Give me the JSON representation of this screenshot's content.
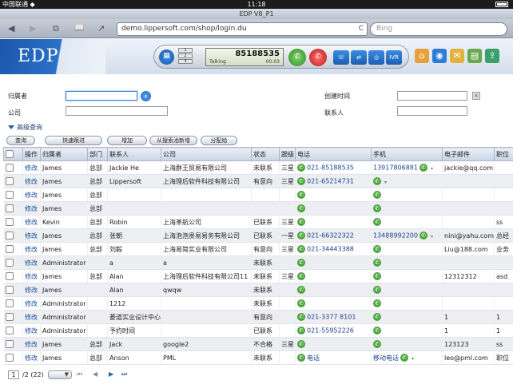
{
  "statusbar": {
    "carrier": "中国联通 ◆",
    "time": "11:18"
  },
  "browser": {
    "title": "EDP V8_P1",
    "url": "demo.lippersoft.com/shop/login.du",
    "search_placeholder": "Bing",
    "back": "◀",
    "forward": "▶",
    "tabs": "⧉",
    "bookmarks": "📖",
    "share": "↗",
    "reload": "C"
  },
  "header": {
    "logo": "EDP",
    "phone": {
      "lines": [
        "1",
        "2",
        "3"
      ],
      "number": "85188535",
      "state": "Talking",
      "duration": "00:03",
      "ivr": "IVR"
    }
  },
  "filter": {
    "owner_label": "归属者",
    "company_label": "公司",
    "created_label": "创建时间",
    "contact_label": "联系人"
  },
  "advanced": "高级查询",
  "toolbar": [
    "查询",
    "快速跟进",
    "增加",
    "从搜索池新增",
    "分配给"
  ],
  "table": {
    "headers": [
      "",
      "操作",
      "归属者",
      "部门",
      "联系人",
      "公司",
      "状态",
      "跟级",
      "电话",
      "手机",
      "电子邮件",
      "职位"
    ],
    "rows": [
      {
        "op": "修改",
        "owner": "James",
        "dept": "总部",
        "contact": "Jackie He",
        "company": "上海群王贸易有限公司",
        "status": "未联系",
        "level": "三星",
        "phone": "021-85188535",
        "mobile": "13917806881",
        "email": "jackie@qq.com",
        "title": ""
      },
      {
        "op": "修改",
        "owner": "James",
        "dept": "总部",
        "contact": "Lippersoft",
        "company": "上海理后软件科技有限公司",
        "status": "有意向",
        "level": "三星",
        "phone": "021-65214731",
        "mobile": "",
        "email": "",
        "title": ""
      },
      {
        "op": "修改",
        "owner": "James",
        "dept": "总部",
        "contact": "",
        "company": "",
        "status": "",
        "level": "",
        "phone": "",
        "mobile": "",
        "email": "",
        "title": ""
      },
      {
        "op": "修改",
        "owner": "James",
        "dept": "总部",
        "contact": "",
        "company": "",
        "status": "",
        "level": "",
        "phone": "",
        "mobile": "",
        "email": "",
        "title": ""
      },
      {
        "op": "修改",
        "owner": "Kevin",
        "dept": "总部",
        "contact": "Robin",
        "company": "上海革航公司",
        "status": "已联系",
        "level": "三星",
        "phone": "",
        "mobile": "",
        "email": "",
        "title": "ss"
      },
      {
        "op": "修改",
        "owner": "James",
        "dept": "总部",
        "contact": "张朝",
        "company": "上海泡泡贵易易务有限公司",
        "status": "已联系",
        "level": "一星",
        "phone": "021-66322322",
        "mobile": "13488992200",
        "email": "nini@yahu.com",
        "title": "总经"
      },
      {
        "op": "修改",
        "owner": "James",
        "dept": "总部",
        "contact": "刘毅",
        "company": "上海易简实业有限公司",
        "status": "有意向",
        "level": "三星",
        "phone": "021-34443388",
        "mobile": "",
        "email": "Liu@188.com",
        "title": "业务"
      },
      {
        "op": "修改",
        "owner": "Administrator",
        "dept": "",
        "contact": "a",
        "company": "a",
        "status": "未联系",
        "level": "",
        "phone": "",
        "mobile": "",
        "email": "",
        "title": ""
      },
      {
        "op": "修改",
        "owner": "James",
        "dept": "总部",
        "contact": "Alan",
        "company": "上海理后软件科技有限公司11",
        "status": "未联系",
        "level": "三星",
        "phone": "",
        "mobile": "",
        "email": "12312312",
        "title": "asd"
      },
      {
        "op": "修改",
        "owner": "James",
        "dept": "",
        "contact": "Alan",
        "company": "qwqw",
        "status": "未联系",
        "level": "",
        "phone": "",
        "mobile": "",
        "email": "",
        "title": ""
      },
      {
        "op": "修改",
        "owner": "Administrator",
        "dept": "",
        "contact": "1212",
        "company": "",
        "status": "未联系",
        "level": "",
        "phone": "",
        "mobile": "",
        "email": "",
        "title": ""
      },
      {
        "op": "修改",
        "owner": "Administrator",
        "dept": "",
        "contact": "菱道实业设计中心",
        "company": "",
        "status": "有意向",
        "level": "",
        "phone": "021-3377 8101",
        "mobile": "",
        "email": "1",
        "title": "1"
      },
      {
        "op": "修改",
        "owner": "Administrator",
        "dept": "",
        "contact": "予约时间",
        "company": "",
        "status": "已联系",
        "level": "",
        "phone": "021-55952226",
        "mobile": "",
        "email": "1",
        "title": "1"
      },
      {
        "op": "修改",
        "owner": "James",
        "dept": "总部",
        "contact": "Jack",
        "company": "google2",
        "status": "不合格",
        "level": "三星",
        "phone": "",
        "mobile": "",
        "email": "123123",
        "title": "ss"
      },
      {
        "op": "修改",
        "owner": "James",
        "dept": "总部",
        "contact": "Anson",
        "company": "PML",
        "status": "未联系",
        "level": "",
        "phone": "电话",
        "mobile": "移动电话",
        "email": "leo@pml.com",
        "title": "职位"
      }
    ],
    "phone_icons": [
      true,
      true,
      true,
      true,
      true,
      true,
      true,
      true,
      true,
      true,
      true,
      true,
      true,
      true,
      true
    ],
    "mobile_icons": [
      true,
      true,
      true,
      true,
      true,
      true,
      true,
      true,
      true,
      true,
      true,
      true,
      true,
      true,
      true
    ],
    "email_dropdown": [
      true,
      true,
      false,
      false,
      false,
      true,
      false,
      false,
      false,
      false,
      false,
      false,
      false,
      false,
      true
    ]
  },
  "pager": {
    "page": "1",
    "total": "/2 (22)"
  }
}
